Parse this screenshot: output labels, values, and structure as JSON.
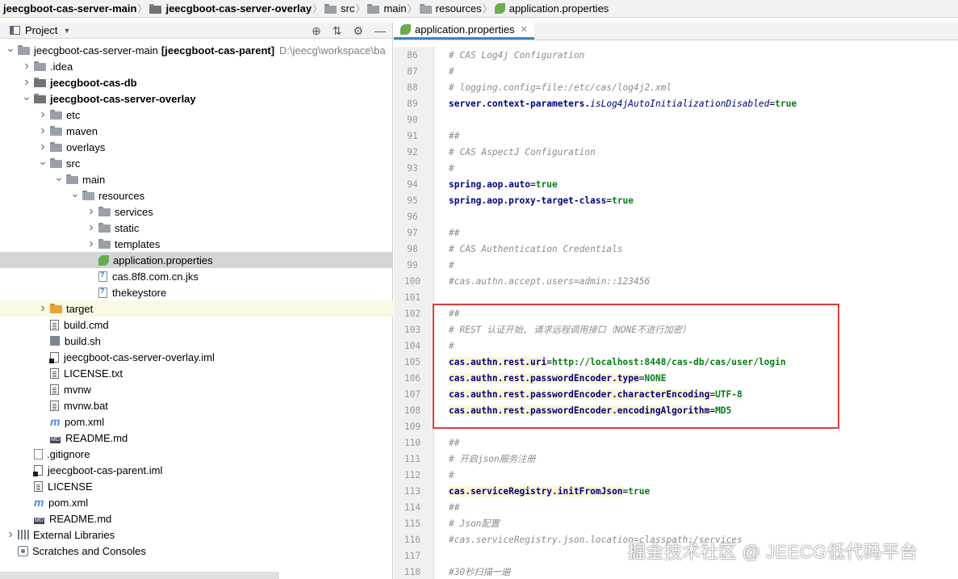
{
  "breadcrumb": [
    {
      "label": "jeecgboot-cas-server-main",
      "bold": true,
      "icon": "folder-icon"
    },
    {
      "label": "jeecgboot-cas-server-overlay",
      "bold": true,
      "icon": "folder-icon"
    },
    {
      "label": "src",
      "bold": false,
      "icon": "folder-icon"
    },
    {
      "label": "main",
      "bold": false,
      "icon": "folder-icon"
    },
    {
      "label": "resources",
      "bold": false,
      "icon": "resources-folder-icon"
    },
    {
      "label": "application.properties",
      "bold": false,
      "icon": "spring-leaf-icon"
    }
  ],
  "project": {
    "title": "Project",
    "tree": [
      {
        "depth": 0,
        "arrow": "down",
        "icon": "folder",
        "label": "jeecgboot-cas-server-main",
        "suffix": "[jeecgboot-cas-parent]",
        "path": "D:\\jeecg\\workspace\\ba",
        "bold_label": false
      },
      {
        "depth": 1,
        "arrow": "right",
        "icon": "folder",
        "label": ".idea"
      },
      {
        "depth": 1,
        "arrow": "right",
        "icon": "folder-dark",
        "label": "jeecgboot-cas-db",
        "bold_label": true
      },
      {
        "depth": 1,
        "arrow": "down",
        "icon": "folder-dark",
        "label": "jeecgboot-cas-server-overlay",
        "bold_label": true
      },
      {
        "depth": 2,
        "arrow": "right",
        "icon": "folder",
        "label": "etc"
      },
      {
        "depth": 2,
        "arrow": "right",
        "icon": "folder",
        "label": "maven"
      },
      {
        "depth": 2,
        "arrow": "right",
        "icon": "folder",
        "label": "overlays"
      },
      {
        "depth": 2,
        "arrow": "down",
        "icon": "folder",
        "label": "src"
      },
      {
        "depth": 3,
        "arrow": "down",
        "icon": "folder",
        "label": "main"
      },
      {
        "depth": 4,
        "arrow": "down",
        "icon": "folder-res",
        "label": "resources"
      },
      {
        "depth": 5,
        "arrow": "right",
        "icon": "folder",
        "label": "services"
      },
      {
        "depth": 5,
        "arrow": "right",
        "icon": "folder",
        "label": "static"
      },
      {
        "depth": 5,
        "arrow": "right",
        "icon": "folder",
        "label": "templates"
      },
      {
        "depth": 5,
        "arrow": "none",
        "icon": "leaf",
        "label": "application.properties",
        "selected": true
      },
      {
        "depth": 5,
        "arrow": "none",
        "icon": "keystore",
        "label": "cas.8f8.com.cn.jks"
      },
      {
        "depth": 5,
        "arrow": "none",
        "icon": "keystore",
        "label": "thekeystore"
      },
      {
        "depth": 2,
        "arrow": "right",
        "icon": "folder-orange",
        "label": "target",
        "highlight": true
      },
      {
        "depth": 2,
        "arrow": "none",
        "icon": "file",
        "label": "build.cmd"
      },
      {
        "depth": 2,
        "arrow": "none",
        "icon": "term",
        "label": "build.sh"
      },
      {
        "depth": 2,
        "arrow": "none",
        "icon": "iml",
        "label": "jeecgboot-cas-server-overlay.iml"
      },
      {
        "depth": 2,
        "arrow": "none",
        "icon": "file",
        "label": "LICENSE.txt"
      },
      {
        "depth": 2,
        "arrow": "none",
        "icon": "file",
        "label": "mvnw"
      },
      {
        "depth": 2,
        "arrow": "none",
        "icon": "file",
        "label": "mvnw.bat"
      },
      {
        "depth": 2,
        "arrow": "none",
        "icon": "maven",
        "label": "pom.xml"
      },
      {
        "depth": 2,
        "arrow": "none",
        "icon": "md",
        "label": "README.md"
      },
      {
        "depth": 1,
        "arrow": "none",
        "icon": "git",
        "label": ".gitignore"
      },
      {
        "depth": 1,
        "arrow": "none",
        "icon": "iml",
        "label": "jeecgboot-cas-parent.iml"
      },
      {
        "depth": 1,
        "arrow": "none",
        "icon": "file",
        "label": "LICENSE"
      },
      {
        "depth": 1,
        "arrow": "none",
        "icon": "maven",
        "label": "pom.xml"
      },
      {
        "depth": 1,
        "arrow": "none",
        "icon": "md",
        "label": "README.md"
      },
      {
        "depth": 0,
        "arrow": "right",
        "icon": "lib",
        "label": "External Libraries"
      },
      {
        "depth": 0,
        "arrow": "none",
        "icon": "scratch",
        "label": "Scratches and Consoles"
      }
    ]
  },
  "editor": {
    "tab_label": "application.properties",
    "lines": [
      {
        "n": "86",
        "type": "comment",
        "text": "# CAS Log4j Configuration"
      },
      {
        "n": "87",
        "type": "comment",
        "text": "#"
      },
      {
        "n": "88",
        "type": "comment",
        "text": "# logging.config=file:/etc/cas/log4j2.xml"
      },
      {
        "n": "89",
        "type": "prop",
        "key": "server.context-parameters.",
        "key_italic": "isLog4jAutoInitializationDisabled",
        "value": "true"
      },
      {
        "n": "90",
        "type": "blank",
        "text": ""
      },
      {
        "n": "91",
        "type": "comment",
        "text": "##"
      },
      {
        "n": "92",
        "type": "comment",
        "text": "# CAS AspectJ Configuration"
      },
      {
        "n": "93",
        "type": "comment",
        "text": "#"
      },
      {
        "n": "94",
        "type": "prop",
        "key": "spring.aop.auto",
        "value": "true"
      },
      {
        "n": "95",
        "type": "prop",
        "key": "spring.aop.proxy-target-class",
        "value": "true"
      },
      {
        "n": "96",
        "type": "blank",
        "text": ""
      },
      {
        "n": "97",
        "type": "comment",
        "text": "##"
      },
      {
        "n": "98",
        "type": "comment",
        "text": "# CAS Authentication Credentials"
      },
      {
        "n": "99",
        "type": "comment",
        "text": "#"
      },
      {
        "n": "100",
        "type": "comment",
        "text": "#cas.authn.accept.users=admin::123456"
      },
      {
        "n": "101",
        "type": "blank",
        "text": ""
      },
      {
        "n": "102",
        "type": "comment",
        "text": "##"
      },
      {
        "n": "103",
        "type": "comment",
        "text": "# REST 认证开始, 请求远程调用接口（NONE不进行加密）"
      },
      {
        "n": "104",
        "type": "comment",
        "text": "#"
      },
      {
        "n": "105",
        "type": "prop",
        "key": "cas.authn.rest.uri",
        "value": "http://localhost:8448/cas-db/cas/user/login",
        "hl": true
      },
      {
        "n": "106",
        "type": "prop",
        "key": "cas.authn.rest.passwordEncoder.type",
        "value": "NONE",
        "hl": true
      },
      {
        "n": "107",
        "type": "prop",
        "key": "cas.authn.rest.passwordEncoder.characterEncoding",
        "value": "UTF-8",
        "hl": true
      },
      {
        "n": "108",
        "type": "prop",
        "key": "cas.authn.rest.passwordEncoder.encodingAlgorithm",
        "value": "MD5",
        "hl": true
      },
      {
        "n": "109",
        "type": "blank",
        "text": ""
      },
      {
        "n": "110",
        "type": "comment",
        "text": "##"
      },
      {
        "n": "111",
        "type": "comment",
        "text": "# 开启json服务注册"
      },
      {
        "n": "112",
        "type": "comment",
        "text": "#"
      },
      {
        "n": "113",
        "type": "prop",
        "key": "cas.serviceRegistry.initFromJson",
        "value": "true",
        "hl": true
      },
      {
        "n": "114",
        "type": "comment",
        "text": "##"
      },
      {
        "n": "115",
        "type": "comment",
        "text": "# Json配置"
      },
      {
        "n": "116",
        "type": "comment",
        "text": "#cas.serviceRegistry.json.location=classpath:/services"
      },
      {
        "n": "117",
        "type": "blank",
        "text": ""
      },
      {
        "n": "118",
        "type": "comment",
        "text": "#30秒扫描一遍"
      }
    ]
  },
  "watermark": "掘金技术社区 @ JEECG低代码平台",
  "colors": {
    "accent": "#4083c9",
    "selection": "#d5d5d5",
    "annotation_box": "#e03c3c"
  }
}
